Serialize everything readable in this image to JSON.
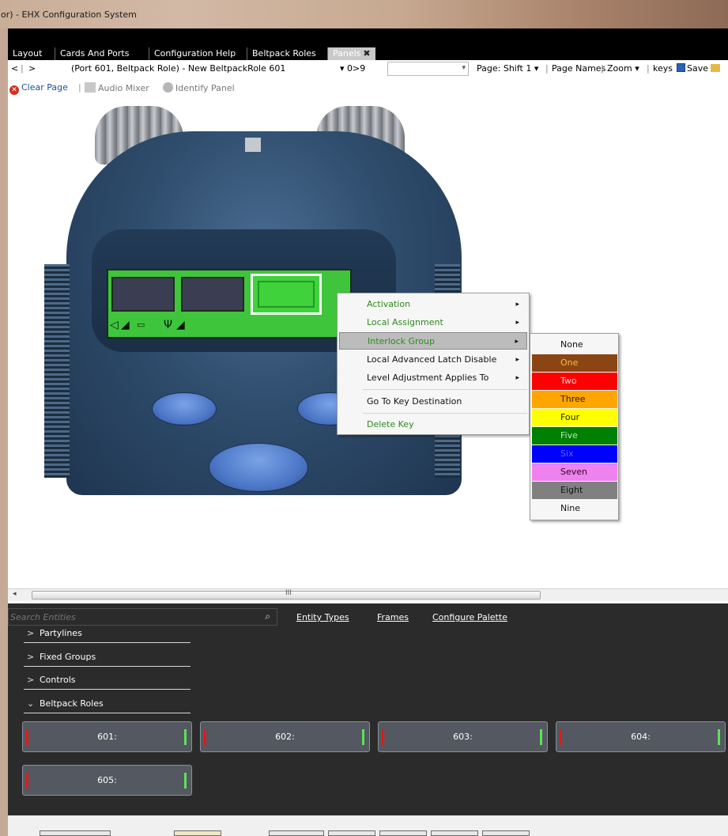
{
  "window": {
    "title": "or) - EHX Configuration System"
  },
  "tabs": [
    {
      "label": "Layout",
      "active": false
    },
    {
      "label": "Cards And Ports",
      "active": false
    },
    {
      "label": "Configuration Help",
      "active": false
    },
    {
      "label": "Beltpack Roles",
      "active": false
    },
    {
      "label": "Panels",
      "active": true,
      "close": "✖"
    }
  ],
  "navbar": {
    "back": "<",
    "forward": ">",
    "panel_name": "(Port 601, Beltpack Role)  -  New BeltpackRole 601",
    "key_range": "▾  0>9",
    "page_label": "Page: Shift 1 ▾",
    "page_names": "Page Names",
    "zoom": "Zoom ▾",
    "keys": "keys",
    "save": "Save"
  },
  "actionbar": {
    "clear_page": "Clear Page",
    "audio_mixer": "Audio Mixer",
    "identify_panel": "Identify Panel"
  },
  "context_menu": {
    "items": [
      {
        "label": "Activation",
        "has_submenu": true
      },
      {
        "label": "Local Assignment",
        "has_submenu": true
      },
      {
        "label": "Interlock Group",
        "has_submenu": true,
        "highlighted": true
      },
      {
        "label": "Local Advanced Latch Disable",
        "has_submenu": true
      },
      {
        "label": "Level Adjustment Applies To",
        "has_submenu": true
      },
      {
        "label": "Go To Key Destination",
        "has_submenu": false
      },
      {
        "label": "Delete Key",
        "has_submenu": false
      }
    ],
    "submenu_arrow": "▸"
  },
  "interlock_submenu": [
    {
      "label": "None",
      "bg": "#f6f6f6",
      "fg": "#111111"
    },
    {
      "label": "One",
      "bg": "#8b4513",
      "fg": "#f0c040"
    },
    {
      "label": "Two",
      "bg": "#ff0000",
      "fg": "#f0d8d8"
    },
    {
      "label": "Three",
      "bg": "#ffa500",
      "fg": "#2b1b00"
    },
    {
      "label": "Four",
      "bg": "#ffff00",
      "fg": "#222200"
    },
    {
      "label": "Five",
      "bg": "#008000",
      "fg": "#b8e6b8"
    },
    {
      "label": "Six",
      "bg": "#0000ff",
      "fg": "#6666ff"
    },
    {
      "label": "Seven",
      "bg": "#ee82ee",
      "fg": "#2a0a2a"
    },
    {
      "label": "Eight",
      "bg": "#808080",
      "fg": "#111111"
    },
    {
      "label": "Nine",
      "bg": "#f6f6f6",
      "fg": "#111111"
    }
  ],
  "scrollbar": {
    "left_arrow": "◂",
    "grip": "III"
  },
  "palette": {
    "search_placeholder": "Search Entities",
    "links": [
      "Entity Types",
      "Frames",
      "Configure Palette"
    ],
    "groups": [
      {
        "label": "Partylines",
        "expanded": false,
        "chevron": ">"
      },
      {
        "label": "Fixed Groups",
        "expanded": false,
        "chevron": ">"
      },
      {
        "label": "Controls",
        "expanded": false,
        "chevron": ">"
      },
      {
        "label": "Beltpack Roles",
        "expanded": true,
        "chevron": "⌄"
      }
    ],
    "roles": [
      "601:",
      "602:",
      "603:",
      "604:",
      "605:"
    ]
  },
  "colors": {
    "lcd_green": "#3fc53b",
    "menu_green_text": "#2f8a1e",
    "palette_bg": "#2b2b2b"
  },
  "icons": [
    "close-icon",
    "save-icon",
    "folder-icon",
    "clear-icon",
    "audio-mixer-icon",
    "identify-icon",
    "search-icon",
    "chevron-right-icon",
    "chevron-down-icon",
    "submenu-arrow-icon"
  ]
}
